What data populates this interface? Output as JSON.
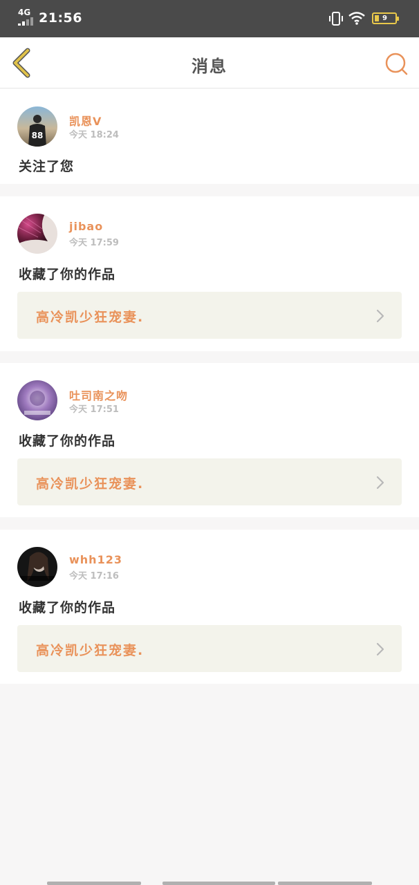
{
  "status_bar": {
    "network": "4G",
    "time": "21:56",
    "battery_level": "9",
    "icons": [
      "signal-icon",
      "vibrate-icon",
      "wifi-icon",
      "battery-icon"
    ]
  },
  "header": {
    "title": "消息",
    "back_icon": "chevron-left-icon",
    "search_icon": "search-icon"
  },
  "colors": {
    "accent": "#e9925a",
    "back_arrow": "#e0c24a",
    "link_bg": "#f3f3eb"
  },
  "messages": [
    {
      "user": "凯恩V",
      "time": "今天 18:24",
      "action": "关注了您"
    },
    {
      "user": "jibao",
      "time": "今天 17:59",
      "action": "收藏了你的作品",
      "work": "高冷凯少狂宠妻."
    },
    {
      "user": "吐司南之吻",
      "time": "今天 17:51",
      "action": "收藏了你的作品",
      "work": "高冷凯少狂宠妻."
    },
    {
      "user": "whh123",
      "time": "今天 17:16",
      "action": "收藏了你的作品",
      "work": "高冷凯少狂宠妻."
    }
  ]
}
